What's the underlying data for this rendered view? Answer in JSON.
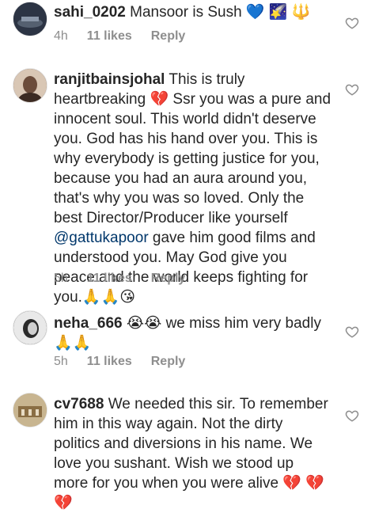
{
  "comments": [
    {
      "username": "sahi_0202",
      "text": "Mansoor is Sush 💙 🌠 🔱",
      "time": "4h",
      "likes": "11 likes",
      "reply": "Reply",
      "avatar_color": "#2c3444"
    },
    {
      "username": "ranjitbainsjohal",
      "text": "This is truly heartbreaking 💔 Ssr you was a pure and innocent soul. This world didn't deserve you. God has his hand over you. This is why everybody is getting justice for you, because you had an aura around you, that's why you was so loved. Only the best Director/Producer like yourself",
      "mention": "@gattukapoor",
      "text2": "gave him good films and understood you. May God give you peace and the world keeps fighting for you.🙏🙏😘",
      "time": "5h",
      "likes": "11 likes",
      "reply": "Reply",
      "avatar_color": "#6b4c3b"
    },
    {
      "username": "neha_666",
      "text": "😭😭 we miss him very badly 🙏🙏",
      "time": "5h",
      "likes": "11 likes",
      "reply": "Reply",
      "avatar_color": "#2a2a2a"
    },
    {
      "username": "cv7688",
      "text": "We needed this sir. To remember him in this way again. Not the dirty politics and diversions in his name. We love you sushant. Wish we stood up more for you when you were alive 💔 💔 💔",
      "avatar_color": "#b89c6a"
    }
  ],
  "colors": {
    "mention": "#00376b",
    "meta": "#8e8e8e",
    "heart_stroke": "#8e8e8e"
  },
  "icons": {
    "like": "heart-outline-icon"
  }
}
